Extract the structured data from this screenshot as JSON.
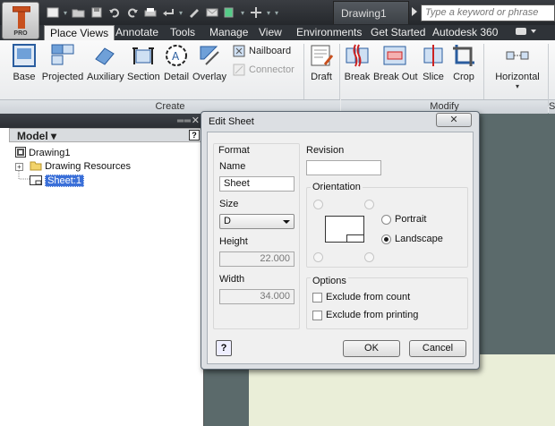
{
  "app": {
    "logo_text": "PRO"
  },
  "document_tab": "Drawing1",
  "search": {
    "placeholder": "Type a keyword or phrase"
  },
  "tabs": [
    "Place Views",
    "Annotate",
    "Tools",
    "Manage",
    "View",
    "Environments",
    "Get Started",
    "Autodesk 360"
  ],
  "active_tab": "Place Views",
  "ribbon": {
    "create_buttons": [
      "Base",
      "Projected",
      "Auxiliary",
      "Section",
      "Detail",
      "Overlay"
    ],
    "small_buttons": [
      {
        "label": "Nailboard",
        "enabled": true
      },
      {
        "label": "Connector",
        "enabled": false
      }
    ],
    "draft_label": "Draft",
    "modify_buttons": [
      "Break",
      "Break Out",
      "Slice",
      "Crop"
    ],
    "horizontal_label": "Horizontal",
    "panel_create": "Create",
    "panel_modify": "Modify",
    "right_edge": "S"
  },
  "browser": {
    "title": "Model",
    "help": "?",
    "tree": {
      "root": "Drawing1",
      "resources": "Drawing Resources",
      "sheet": "Sheet:1"
    }
  },
  "dialog": {
    "title": "Edit Sheet",
    "close": "✕",
    "format": {
      "legend": "Format",
      "name_label": "Name",
      "name_value": "Sheet",
      "size_label": "Size",
      "size_value": "D",
      "height_label": "Height",
      "height_value": "22.000",
      "width_label": "Width",
      "width_value": "34.000"
    },
    "revision": {
      "label": "Revision",
      "value": ""
    },
    "orientation": {
      "legend": "Orientation",
      "portrait": "Portrait",
      "landscape": "Landscape",
      "selected": "Landscape"
    },
    "options": {
      "legend": "Options",
      "exclude_count": "Exclude from count",
      "exclude_printing": "Exclude from printing",
      "exclude_count_checked": false,
      "exclude_printing_checked": false
    },
    "help": "?",
    "ok": "OK",
    "cancel": "Cancel"
  },
  "colors": {
    "accent": "#3a6fd8",
    "title_bar": "#2f3338",
    "sheet_background": "#eaeed8",
    "workspace": "#5b6a6b"
  }
}
